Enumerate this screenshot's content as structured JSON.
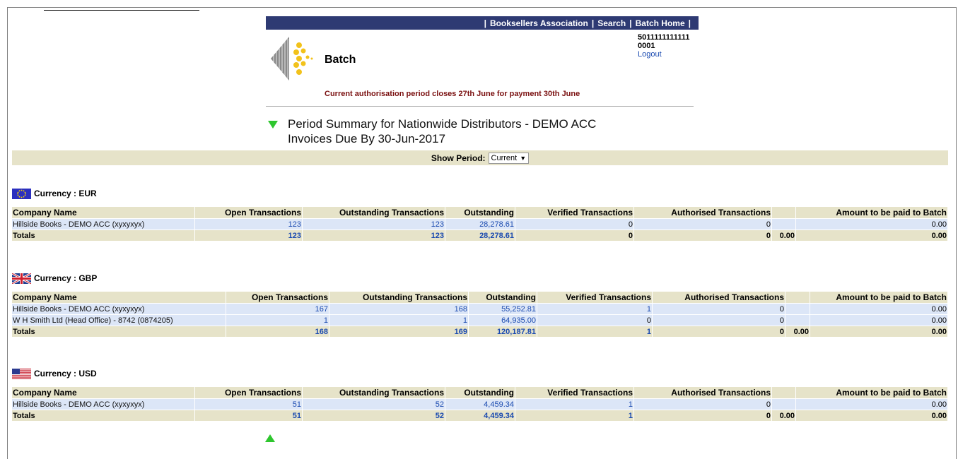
{
  "header": {
    "nav": [
      "Booksellers Association",
      "Search",
      "Batch Home"
    ],
    "brand": "Batch",
    "account_line1": "5011111111111",
    "account_line2": "0001",
    "logout": "Logout",
    "notice": "Current authorisation period closes 27th June for payment 30th June"
  },
  "summary": {
    "line1": "Period Summary for Nationwide Distributors - DEMO ACC",
    "line2": "Invoices Due By 30-Jun-2017"
  },
  "period": {
    "label": "Show Period:",
    "selected": "Current"
  },
  "columns": [
    "Company Name",
    "Open Transactions",
    "Outstanding Transactions",
    "Outstanding",
    "Verified Transactions",
    "Authorised Transactions",
    "",
    "Amount to be paid to Batch"
  ],
  "sections": [
    {
      "title": "Currency : EUR",
      "rows": [
        [
          "Hillside Books - DEMO ACC (xyxyxyx)",
          "123",
          "123",
          "28,278.61",
          "0",
          "0",
          "",
          "0.00"
        ]
      ],
      "totals": [
        "Totals",
        "123",
        "123",
        "28,278.61",
        "0",
        "0",
        "0.00",
        "0.00"
      ]
    },
    {
      "title": "Currency : GBP",
      "rows": [
        [
          "Hillside Books - DEMO ACC (xyxyxyx)",
          "167",
          "168",
          "55,252.81",
          "1",
          "0",
          "",
          "0.00"
        ],
        [
          "W H Smith Ltd (Head Office) - 8742 (0874205)",
          "1",
          "1",
          "64,935.00",
          "0",
          "0",
          "",
          "0.00"
        ]
      ],
      "totals": [
        "Totals",
        "168",
        "169",
        "120,187.81",
        "1",
        "0",
        "0.00",
        "0.00"
      ]
    },
    {
      "title": "Currency : USD",
      "rows": [
        [
          "Hillside Books - DEMO ACC (xyxyxyx)",
          "51",
          "52",
          "4,459.34",
          "1",
          "0",
          "",
          "0.00"
        ]
      ],
      "totals": [
        "Totals",
        "51",
        "52",
        "4,459.34",
        "1",
        "0",
        "0.00",
        "0.00"
      ]
    }
  ]
}
